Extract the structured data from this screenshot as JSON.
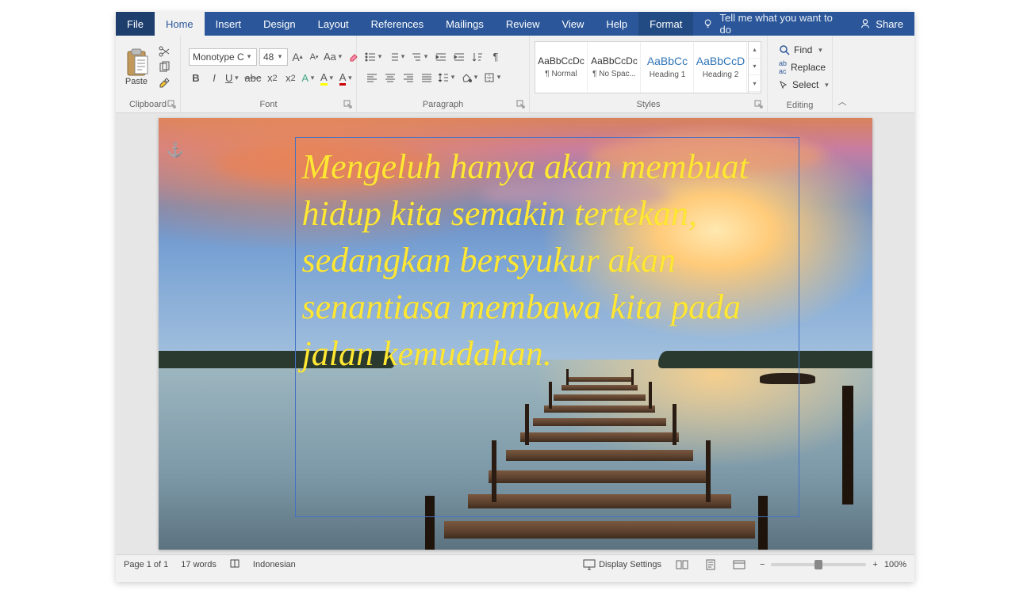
{
  "tabs": {
    "file": "File",
    "home": "Home",
    "insert": "Insert",
    "design": "Design",
    "layout": "Layout",
    "references": "References",
    "mailings": "Mailings",
    "review": "Review",
    "view": "View",
    "help": "Help",
    "format": "Format"
  },
  "tellme": "Tell me what you want to do",
  "share": "Share",
  "ribbon": {
    "clipboard": {
      "label": "Clipboard",
      "paste": "Paste"
    },
    "font": {
      "label": "Font",
      "name": "Monotype C",
      "size": "48"
    },
    "paragraph": {
      "label": "Paragraph"
    },
    "styles": {
      "label": "Styles",
      "items": [
        {
          "preview": "AaBbCcDc",
          "name": "¶ Normal"
        },
        {
          "preview": "AaBbCcDc",
          "name": "¶ No Spac..."
        },
        {
          "preview": "AaBbCc",
          "name": "Heading 1",
          "h": true
        },
        {
          "preview": "AaBbCcD",
          "name": "Heading 2",
          "h": true
        }
      ]
    },
    "editing": {
      "label": "Editing",
      "find": "Find",
      "replace": "Replace",
      "select": "Select"
    }
  },
  "document": {
    "text": "Mengeluh hanya akan membuat hidup kita semakin tertekan, sedangkan bersyukur akan senantiasa membawa kita pada jalan kemudahan."
  },
  "status": {
    "page": "Page 1 of 1",
    "words": "17 words",
    "language": "Indonesian",
    "display": "Display Settings",
    "zoom": "100%"
  }
}
